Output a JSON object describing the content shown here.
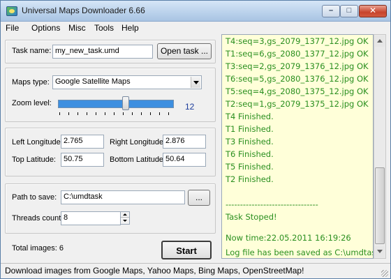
{
  "window": {
    "title": "Universal Maps Downloader 6.66",
    "minimize_glyph": "–",
    "maximize_glyph": "□",
    "close_glyph": "✕"
  },
  "menu": {
    "items": [
      "File",
      "Options",
      "Misc",
      "Tools",
      "Help"
    ]
  },
  "task": {
    "label": "Task name:",
    "value": "my_new_task.umd",
    "open_button": "Open task ..."
  },
  "maps": {
    "type_label": "Maps type:",
    "type_value": "Google Satellite Maps",
    "zoom_label": "Zoom level:",
    "zoom_value": "12"
  },
  "coords": {
    "left_lon_label": "Left Longitude:",
    "left_lon_value": "2.765",
    "right_lon_label": "Right Longitude:",
    "right_lon_value": "2.876",
    "top_lat_label": "Top Latitude:",
    "top_lat_value": "50.75",
    "bottom_lat_label": "Bottom Latitude:",
    "bottom_lat_value": "50.64"
  },
  "save": {
    "path_label": "Path to save:",
    "path_value": "C:\\umdtask",
    "browse_button": "...",
    "threads_label": "Threads count:",
    "threads_value": "8"
  },
  "footer": {
    "total_images": "Total images: 6",
    "start_button": "Start"
  },
  "log": {
    "lines": [
      "T4:seq=3,gs_2079_1377_12.jpg OK",
      "T1:seq=6,gs_2080_1377_12.jpg OK",
      "T3:seq=2,gs_2079_1376_12.jpg OK",
      "T6:seq=5,gs_2080_1376_12.jpg OK",
      "T5:seq=4,gs_2080_1375_12.jpg OK",
      "T2:seq=1,gs_2079_1375_12.jpg OK",
      "T4 Finished.",
      "T1 Finished.",
      "T3 Finished.",
      "T6 Finished.",
      "T5 Finished.",
      "T2 Finished.",
      "",
      "--------------------------------",
      "Task Stoped!",
      "",
      "Now time:22.05.2011 16:19:26",
      "",
      "Log file has been saved as C:\\umdtask\\"
    ]
  },
  "statusbar": {
    "text": "Download images from Google Maps, Yahoo Maps, Bing Maps, OpenStreetMap!"
  },
  "colors": {
    "log_text": "#2a8f1f",
    "log_background": "#ffffd9",
    "zoom_value_color": "#1a3a9a"
  }
}
